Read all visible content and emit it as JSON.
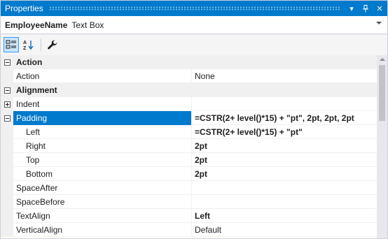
{
  "window": {
    "title": "Properties"
  },
  "colors": {
    "accent": "#007acc",
    "selected_row_bg": "#007acc",
    "category_bg": "#f0f0f0"
  },
  "title_buttons": [
    {
      "name": "dropdown-icon",
      "glyph": "▾"
    },
    {
      "name": "pin-icon",
      "glyph": "⊥"
    },
    {
      "name": "close-icon",
      "glyph": "✕"
    }
  ],
  "selector": {
    "object_name": "EmployeeName",
    "object_type": "Text Box"
  },
  "toolbar": {
    "buttons": [
      {
        "name": "categorized-icon",
        "active": true
      },
      {
        "name": "alphabetical-icon",
        "active": false
      },
      {
        "name": "property-pages-icon",
        "active": false
      }
    ]
  },
  "rows": [
    {
      "kind": "category",
      "expander": "minus",
      "name": "Action"
    },
    {
      "kind": "prop",
      "name": "Action",
      "value": "None",
      "bold": false
    },
    {
      "kind": "category",
      "expander": "minus",
      "name": "Alignment"
    },
    {
      "kind": "prop",
      "expander": "plus",
      "name": "Indent",
      "value": "",
      "bold": false
    },
    {
      "kind": "prop",
      "expander": "minus",
      "name": "Padding",
      "value": "=CSTR(2+ level()*15) + \"pt\", 2pt, 2pt, 2pt",
      "bold": true,
      "selected": true
    },
    {
      "kind": "prop",
      "indent": true,
      "name": "Left",
      "value": "=CSTR(2+ level()*15) + \"pt\"",
      "bold": true
    },
    {
      "kind": "prop",
      "indent": true,
      "name": "Right",
      "value": "2pt",
      "bold": true
    },
    {
      "kind": "prop",
      "indent": true,
      "name": "Top",
      "value": "2pt",
      "bold": true
    },
    {
      "kind": "prop",
      "indent": true,
      "name": "Bottom",
      "value": "2pt",
      "bold": true
    },
    {
      "kind": "prop",
      "name": "SpaceAfter",
      "value": "",
      "bold": false
    },
    {
      "kind": "prop",
      "name": "SpaceBefore",
      "value": "",
      "bold": false
    },
    {
      "kind": "prop",
      "name": "TextAlign",
      "value": "Left",
      "bold": true
    },
    {
      "kind": "prop",
      "name": "VerticalAlign",
      "value": "Default",
      "bold": false
    }
  ]
}
